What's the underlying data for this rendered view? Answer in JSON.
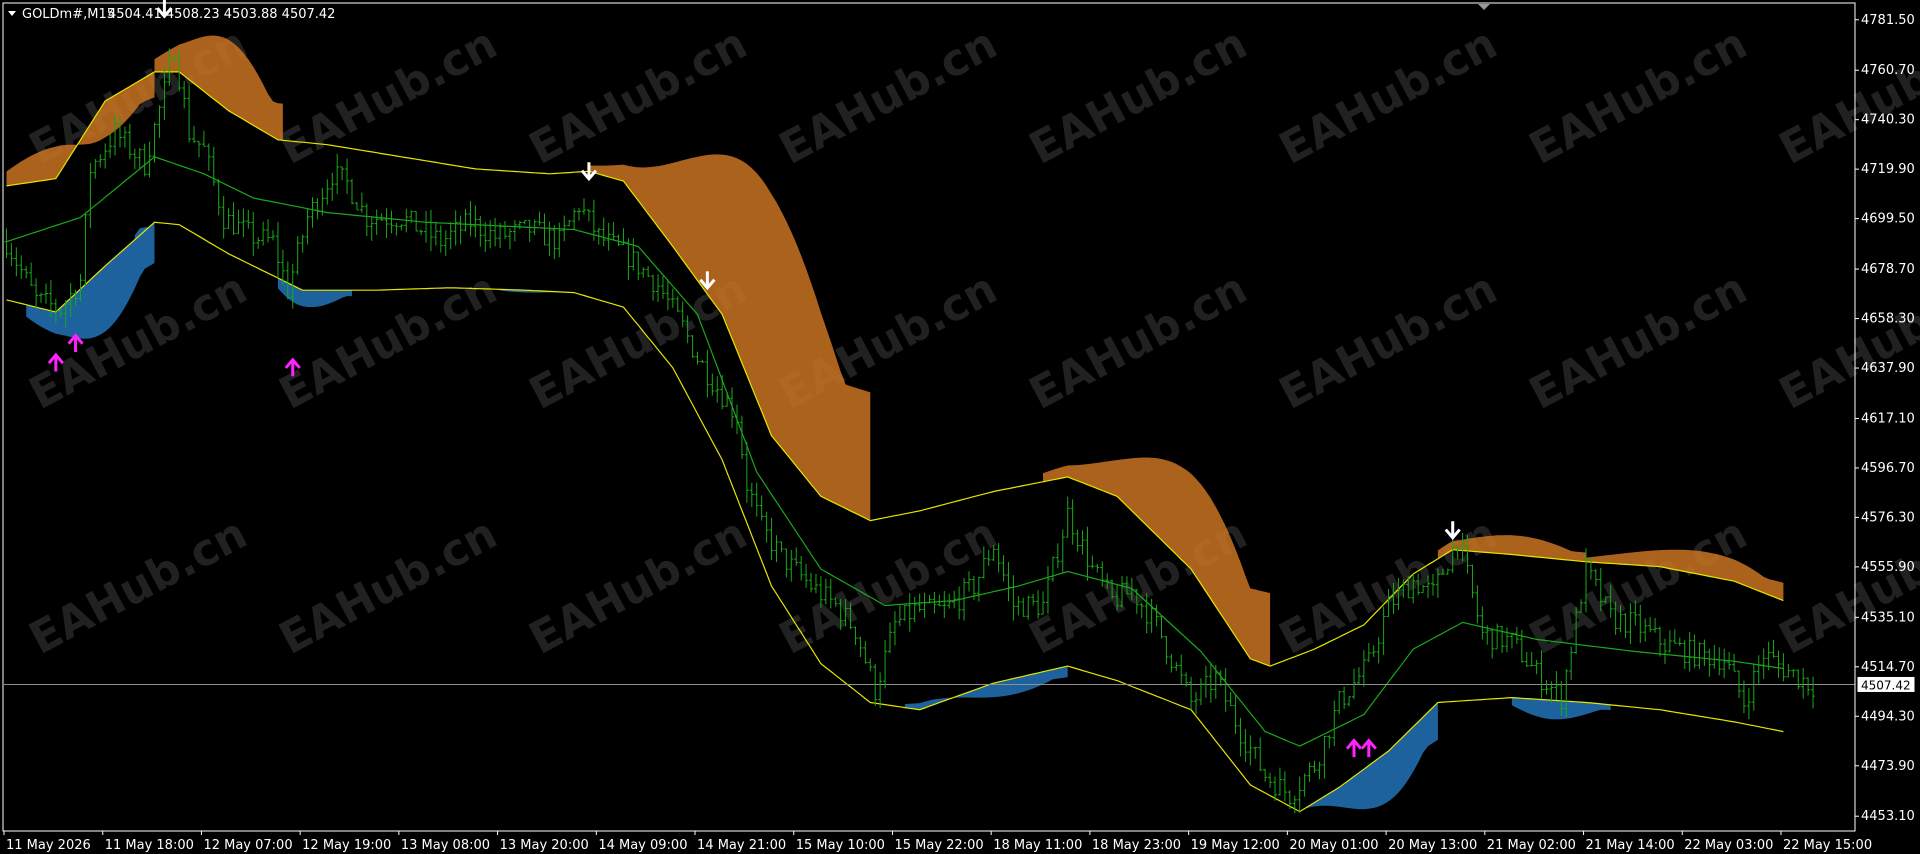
{
  "header": {
    "symbol": "GOLDm#,M15",
    "ohlc": "4504.41 4508.23 4503.88 4507.42"
  },
  "watermark": "EAHub.cn",
  "colors": {
    "background": "#000000",
    "axis": "#ffffff",
    "price": "#1aa81a",
    "band": "#e6e600",
    "mid": "#1aa81a",
    "cloud_up": "#c87322",
    "cloud_down": "#2273b8",
    "arrow_down": "#ffffff",
    "arrow_up": "#ff22ff",
    "current_line": "#8f8f8f"
  },
  "chart_data": {
    "type": "line",
    "x_ticks": [
      "11 May 2026",
      "11 May 18:00",
      "12 May 07:00",
      "12 May 19:00",
      "13 May 08:00",
      "13 May 20:00",
      "14 May 09:00",
      "14 May 21:00",
      "15 May 10:00",
      "15 May 22:00",
      "18 May 11:00",
      "18 May 23:00",
      "19 May 12:00",
      "20 May 01:00",
      "20 May 13:00",
      "21 May 02:00",
      "21 May 14:00",
      "22 May 03:00",
      "22 May 15:00"
    ],
    "y_ticks": [
      "4781.50",
      "4760.70",
      "4740.30",
      "4719.90",
      "4699.50",
      "4678.70",
      "4658.30",
      "4637.90",
      "4617.10",
      "4596.70",
      "4576.30",
      "4555.90",
      "4535.10",
      "4514.70",
      "4494.30",
      "4473.90",
      "4453.10"
    ],
    "ylim": [
      4447,
      4788
    ],
    "n_bars": 375,
    "current_price": 4507.42,
    "current_price_label": "4507.42",
    "price_anchors": [
      [
        0,
        4690
      ],
      [
        6,
        4666
      ],
      [
        11,
        4662
      ],
      [
        15,
        4674
      ],
      [
        17,
        4720
      ],
      [
        22,
        4735
      ],
      [
        28,
        4722
      ],
      [
        32,
        4752
      ],
      [
        34,
        4770
      ],
      [
        37,
        4735
      ],
      [
        40,
        4728
      ],
      [
        44,
        4700
      ],
      [
        50,
        4692
      ],
      [
        54,
        4690
      ],
      [
        57,
        4670
      ],
      [
        61,
        4700
      ],
      [
        66,
        4718
      ],
      [
        69,
        4714
      ],
      [
        73,
        4700
      ],
      [
        80,
        4700
      ],
      [
        88,
        4690
      ],
      [
        94,
        4698
      ],
      [
        99,
        4692
      ],
      [
        106,
        4695
      ],
      [
        112,
        4690
      ],
      [
        116,
        4705
      ],
      [
        120,
        4692
      ],
      [
        126,
        4684
      ],
      [
        132,
        4672
      ],
      [
        137,
        4655
      ],
      [
        140,
        4642
      ],
      [
        144,
        4630
      ],
      [
        148,
        4618
      ],
      [
        150,
        4590
      ],
      [
        153,
        4572
      ],
      [
        157,
        4560
      ],
      [
        163,
        4548
      ],
      [
        168,
        4540
      ],
      [
        172,
        4530
      ],
      [
        176,
        4505
      ],
      [
        180,
        4532
      ],
      [
        184,
        4538
      ],
      [
        190,
        4538
      ],
      [
        196,
        4548
      ],
      [
        200,
        4565
      ],
      [
        204,
        4540
      ],
      [
        210,
        4540
      ],
      [
        215,
        4578
      ],
      [
        220,
        4555
      ],
      [
        224,
        4542
      ],
      [
        228,
        4546
      ],
      [
        233,
        4532
      ],
      [
        240,
        4500
      ],
      [
        245,
        4510
      ],
      [
        250,
        4488
      ],
      [
        255,
        4470
      ],
      [
        260,
        4462
      ],
      [
        265,
        4474
      ],
      [
        270,
        4500
      ],
      [
        276,
        4516
      ],
      [
        280,
        4540
      ],
      [
        285,
        4550
      ],
      [
        289,
        4545
      ],
      [
        294,
        4568
      ],
      [
        299,
        4528
      ],
      [
        305,
        4525
      ],
      [
        310,
        4512
      ],
      [
        315,
        4502
      ],
      [
        320,
        4555
      ],
      [
        325,
        4535
      ],
      [
        330,
        4532
      ],
      [
        336,
        4524
      ],
      [
        342,
        4520
      ],
      [
        348,
        4518
      ],
      [
        352,
        4500
      ],
      [
        356,
        4520
      ],
      [
        360,
        4514
      ],
      [
        366,
        4507
      ]
    ],
    "upper_band": [
      [
        0,
        4713
      ],
      [
        10,
        4716
      ],
      [
        20,
        4748
      ],
      [
        30,
        4760
      ],
      [
        35,
        4760
      ],
      [
        45,
        4744
      ],
      [
        55,
        4732
      ],
      [
        65,
        4730
      ],
      [
        80,
        4725
      ],
      [
        95,
        4720
      ],
      [
        110,
        4718
      ],
      [
        118,
        4719
      ],
      [
        125,
        4715
      ],
      [
        135,
        4688
      ],
      [
        145,
        4660
      ],
      [
        155,
        4610
      ],
      [
        165,
        4585
      ],
      [
        175,
        4575
      ],
      [
        185,
        4579
      ],
      [
        200,
        4587
      ],
      [
        215,
        4593
      ],
      [
        225,
        4585
      ],
      [
        240,
        4555
      ],
      [
        252,
        4518
      ],
      [
        256,
        4515
      ],
      [
        265,
        4522
      ],
      [
        275,
        4532
      ],
      [
        285,
        4553
      ],
      [
        293,
        4563
      ],
      [
        305,
        4561
      ],
      [
        320,
        4558
      ],
      [
        335,
        4556
      ],
      [
        350,
        4550
      ],
      [
        360,
        4542
      ]
    ],
    "lower_band": [
      [
        0,
        4666
      ],
      [
        10,
        4661
      ],
      [
        20,
        4680
      ],
      [
        30,
        4698
      ],
      [
        35,
        4697
      ],
      [
        45,
        4685
      ],
      [
        60,
        4670
      ],
      [
        75,
        4670
      ],
      [
        90,
        4671
      ],
      [
        105,
        4670
      ],
      [
        115,
        4669
      ],
      [
        125,
        4663
      ],
      [
        135,
        4638
      ],
      [
        145,
        4600
      ],
      [
        155,
        4548
      ],
      [
        165,
        4516
      ],
      [
        175,
        4500
      ],
      [
        185,
        4497
      ],
      [
        200,
        4508
      ],
      [
        215,
        4515
      ],
      [
        225,
        4509
      ],
      [
        240,
        4497
      ],
      [
        252,
        4466
      ],
      [
        262,
        4455
      ],
      [
        270,
        4465
      ],
      [
        280,
        4480
      ],
      [
        290,
        4500
      ],
      [
        305,
        4502
      ],
      [
        320,
        4500
      ],
      [
        335,
        4497
      ],
      [
        350,
        4492
      ],
      [
        360,
        4488
      ]
    ],
    "mid_line": [
      [
        0,
        4690
      ],
      [
        15,
        4700
      ],
      [
        30,
        4725
      ],
      [
        40,
        4718
      ],
      [
        50,
        4708
      ],
      [
        65,
        4702
      ],
      [
        85,
        4698
      ],
      [
        115,
        4695
      ],
      [
        128,
        4688
      ],
      [
        140,
        4660
      ],
      [
        152,
        4595
      ],
      [
        165,
        4555
      ],
      [
        178,
        4540
      ],
      [
        192,
        4542
      ],
      [
        205,
        4548
      ],
      [
        215,
        4554
      ],
      [
        228,
        4547
      ],
      [
        242,
        4521
      ],
      [
        255,
        4488
      ],
      [
        262,
        4482
      ],
      [
        275,
        4495
      ],
      [
        285,
        4522
      ],
      [
        295,
        4533
      ],
      [
        310,
        4526
      ],
      [
        330,
        4521
      ],
      [
        350,
        4517
      ],
      [
        360,
        4514
      ]
    ],
    "cloud_up": [
      [
        0,
        30,
        4730
      ],
      [
        30,
        56,
        4775
      ],
      [
        118,
        175,
        4726
      ],
      [
        210,
        256,
        4601
      ],
      [
        290,
        320,
        4569
      ],
      [
        320,
        360,
        4563
      ]
    ],
    "cloud_down": [
      [
        4,
        30,
        4650
      ],
      [
        26,
        30,
        4696
      ],
      [
        55,
        70,
        4663
      ],
      [
        100,
        115,
        4669
      ],
      [
        182,
        215,
        4502
      ],
      [
        262,
        290,
        4456
      ],
      [
        305,
        325,
        4493
      ]
    ],
    "signals_down": [
      [
        32,
        4785
      ],
      [
        118,
        4718
      ],
      [
        142,
        4673
      ],
      [
        293,
        4570
      ]
    ],
    "signals_up": [
      [
        10,
        4647
      ],
      [
        14,
        4655
      ],
      [
        58,
        4645
      ],
      [
        276,
        4488
      ],
      [
        273,
        4488
      ]
    ]
  }
}
